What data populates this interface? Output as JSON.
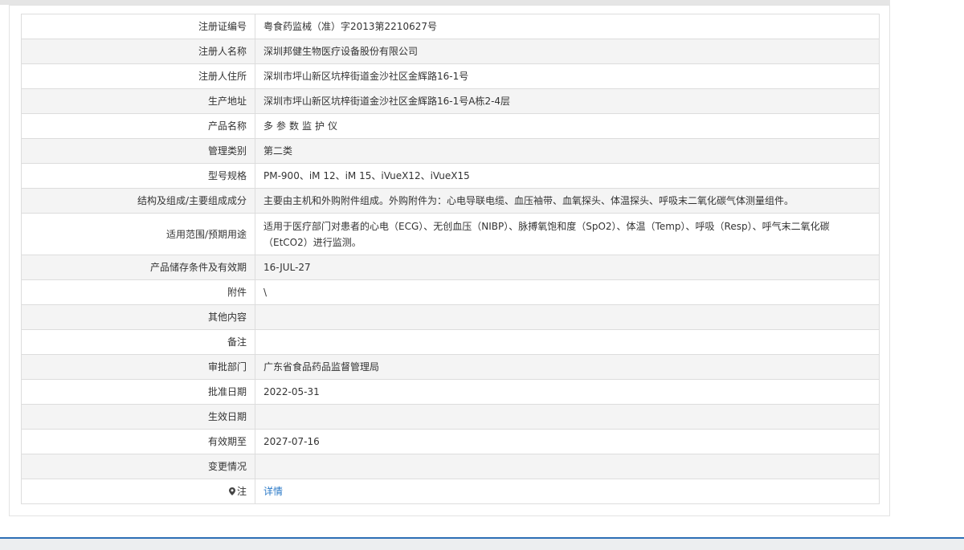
{
  "rows": [
    {
      "label": "注册证编号",
      "value": "粤食药监械（准）字2013第2210627号"
    },
    {
      "label": "注册人名称",
      "value": "深圳邦健生物医疗设备股份有限公司"
    },
    {
      "label": "注册人住所",
      "value": "深圳市坪山新区坑梓街道金沙社区金辉路16-1号"
    },
    {
      "label": "生产地址",
      "value": "深圳市坪山新区坑梓街道金沙社区金辉路16-1号A栋2-4层"
    },
    {
      "label": "产品名称",
      "value": "多参数监护仪"
    },
    {
      "label": "管理类别",
      "value": "第二类"
    },
    {
      "label": "型号规格",
      "value": "PM-900、iM 12、iM 15、iVueX12、iVueX15"
    },
    {
      "label": "结构及组成/主要组成成分",
      "value": "主要由主机和外购附件组成。外购附件为：心电导联电缆、血压袖带、血氧探头、体温探头、呼吸末二氧化碳气体测量组件。"
    },
    {
      "label": "适用范围/预期用途",
      "value": "适用于医疗部门对患者的心电（ECG）、无创血压（NIBP）、脉搏氧饱和度（SpO2）、体温（Temp）、呼吸（Resp）、呼气末二氧化碳（EtCO2）进行监测。"
    },
    {
      "label": "产品储存条件及有效期",
      "value": "16-JUL-27"
    },
    {
      "label": "附件",
      "value": "\\"
    },
    {
      "label": "其他内容",
      "value": ""
    },
    {
      "label": "备注",
      "value": ""
    },
    {
      "label": "审批部门",
      "value": "广东省食品药品监督管理局"
    },
    {
      "label": "批准日期",
      "value": "2022-05-31"
    },
    {
      "label": "生效日期",
      "value": ""
    },
    {
      "label": "有效期至",
      "value": "2027-07-16"
    },
    {
      "label": "变更情况",
      "value": ""
    },
    {
      "label": "注",
      "value": "详情",
      "icon": "map-pin-icon"
    }
  ],
  "colors": {
    "border": "#dddddd",
    "stripe": "#f4f4f4",
    "link": "#2a79c7",
    "footer_accent": "#2d6fb5"
  }
}
